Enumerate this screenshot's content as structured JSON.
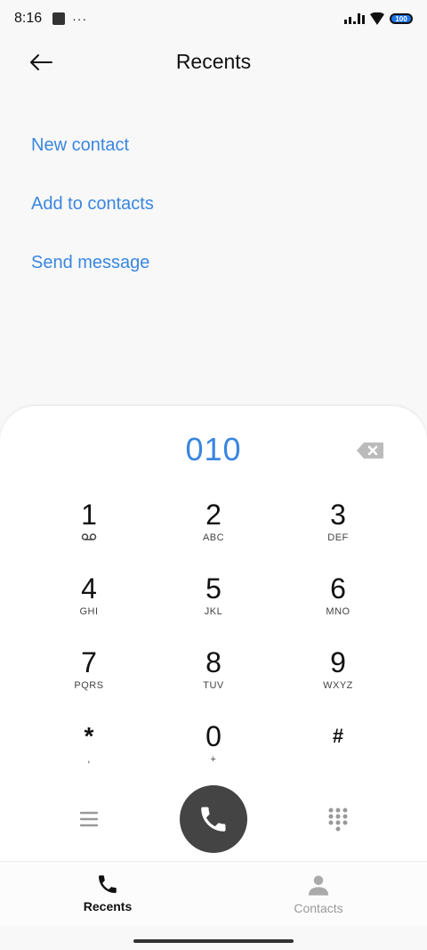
{
  "status_bar": {
    "time": "8:16",
    "more": "···",
    "battery": "100"
  },
  "header": {
    "title": "Recents"
  },
  "options": [
    {
      "label": "New contact"
    },
    {
      "label": "Add to contacts"
    },
    {
      "label": "Send message"
    }
  ],
  "dialer": {
    "number": "010",
    "keys": [
      {
        "digit": "1",
        "letters": ""
      },
      {
        "digit": "2",
        "letters": "ABC"
      },
      {
        "digit": "3",
        "letters": "DEF"
      },
      {
        "digit": "4",
        "letters": "GHI"
      },
      {
        "digit": "5",
        "letters": "JKL"
      },
      {
        "digit": "6",
        "letters": "MNO"
      },
      {
        "digit": "7",
        "letters": "PQRS"
      },
      {
        "digit": "8",
        "letters": "TUV"
      },
      {
        "digit": "9",
        "letters": "WXYZ"
      },
      {
        "digit": "*",
        "letters": ","
      },
      {
        "digit": "0",
        "letters": "+"
      },
      {
        "digit": "#",
        "letters": ""
      }
    ]
  },
  "nav": {
    "recents_label": "Recents",
    "contacts_label": "Contacts"
  },
  "colors": {
    "accent": "#3a86e0",
    "call_button": "#444444",
    "battery": "#1a73e8"
  },
  "icons": {
    "back": "arrow-left-icon",
    "backspace": "backspace-icon",
    "voicemail": "voicemail-icon",
    "menu": "menu-icon",
    "call": "phone-icon",
    "keypad": "dialpad-icon",
    "recents": "phone-icon",
    "contacts": "person-icon"
  }
}
